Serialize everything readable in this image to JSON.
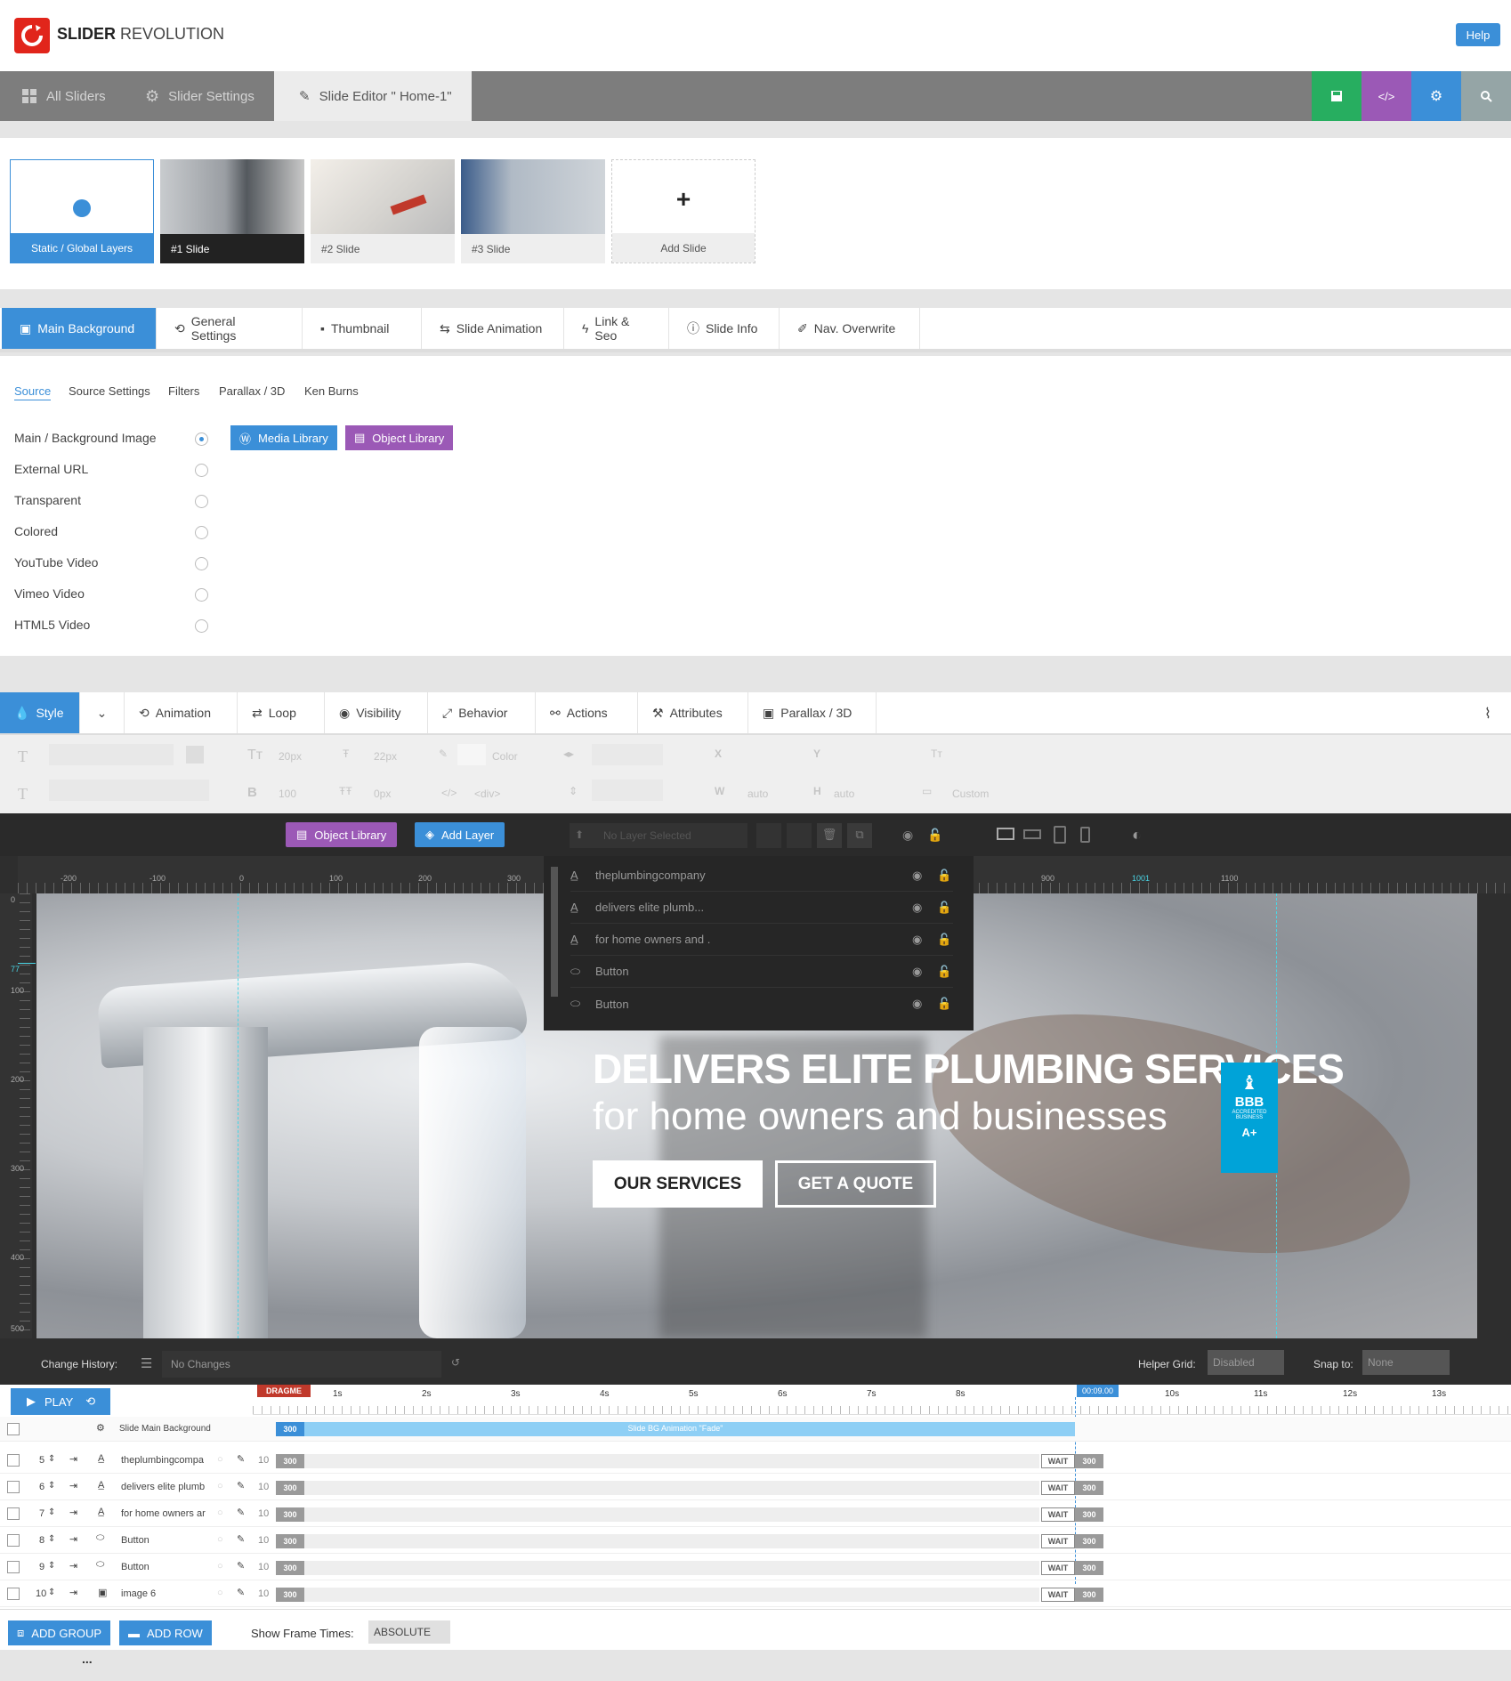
{
  "header": {
    "brand_bold": "SLIDER",
    "brand_light": "REVOLUTION",
    "help_label": "Help"
  },
  "nav": {
    "all_sliders": "All Sliders",
    "slider_settings": "Slider Settings",
    "slide_editor": "Slide Editor \" Home-1\"",
    "buttons": [
      {
        "icon": "save-icon",
        "color": "#27ae60"
      },
      {
        "icon": "code-icon",
        "glyph": "</>",
        "color": "#9b59b6"
      },
      {
        "icon": "gear-icon",
        "color": "#3b8fd8"
      },
      {
        "icon": "search-icon",
        "color": "#95a5a6"
      }
    ]
  },
  "slides": [
    {
      "label": "Static / Global Layers",
      "active": false
    },
    {
      "label": "#1 Slide",
      "active": true
    },
    {
      "label": "#2 Slide",
      "active": false
    },
    {
      "label": "#3 Slide",
      "active": false
    },
    {
      "label": "Add Slide",
      "active": false
    }
  ],
  "main_tabs": [
    "Main Background",
    "General Settings",
    "Thumbnail",
    "Slide Animation",
    "Link & Seo",
    "Slide Info",
    "Nav. Overwrite"
  ],
  "source_subtabs": [
    "Source",
    "Source Settings",
    "Filters",
    "Parallax / 3D",
    "Ken Burns"
  ],
  "source_options": [
    {
      "label": "Main / Background Image",
      "selected": true
    },
    {
      "label": "External URL",
      "selected": false
    },
    {
      "label": "Transparent",
      "selected": false
    },
    {
      "label": "Colored",
      "selected": false
    },
    {
      "label": "YouTube Video",
      "selected": false
    },
    {
      "label": "Vimeo Video",
      "selected": false
    },
    {
      "label": "HTML5 Video",
      "selected": false
    }
  ],
  "library_buttons": {
    "media": "Media Library",
    "object": "Object Library"
  },
  "layer_tabs": [
    "Style",
    "Animation",
    "Loop",
    "Visibility",
    "Behavior",
    "Actions",
    "Attributes",
    "Parallax / 3D"
  ],
  "style_toolbar": {
    "font_size": "20px",
    "line_height": "22px",
    "color_label": "Color",
    "font_weight": "100",
    "letter_spacing": "0px",
    "tag": "<div>",
    "x_label": "X",
    "y_label": "Y",
    "w_label": "W",
    "w_value": "auto",
    "h_label": "H",
    "h_value": "auto",
    "custom": "Custom"
  },
  "editor": {
    "object_library": "Object Library",
    "add_layer": "Add Layer",
    "no_layer": "No Layer Selected",
    "ruler_h": [
      "-200",
      "-100",
      "0",
      "100",
      "200",
      "300",
      "900",
      "1001",
      "1100"
    ],
    "ruler_v": [
      "0",
      "77",
      "100",
      "200",
      "300",
      "400",
      "500"
    ],
    "layers": [
      {
        "name": "theplumbingcompany",
        "icon": "text-icon"
      },
      {
        "name": "delivers elite plumb...",
        "icon": "text-icon"
      },
      {
        "name": "for home owners and .",
        "icon": "text-icon"
      },
      {
        "name": "Button",
        "icon": "button-icon"
      },
      {
        "name": "Button",
        "icon": "button-icon"
      }
    ],
    "headline": "DELIVERS ELITE PLUMBING SERVICES",
    "subheadline": "for home owners and businesses",
    "btn1": "OUR SERVICES",
    "btn2": "GET A QUOTE",
    "bbb": {
      "top": "BBB",
      "sub1": "ACCREDITED",
      "sub2": "BUSINESS",
      "rating": "A+"
    }
  },
  "change_history": {
    "label": "Change History:",
    "value": "No Changes",
    "helper_grid_label": "Helper Grid:",
    "helper_grid_value": "Disabled",
    "snap_label": "Snap to:",
    "snap_value": "None"
  },
  "timeline": {
    "play": "PLAY",
    "dragme": "DRAGME",
    "end_time": "00:09.00",
    "ticks": [
      "1s",
      "2s",
      "3s",
      "4s",
      "5s",
      "6s",
      "7s",
      "8s",
      "10s",
      "11s",
      "12s",
      "13s"
    ],
    "bg_row": {
      "name": "Slide Main Background",
      "start": "300",
      "anim": "Slide BG Animation \"Fade\""
    },
    "rows": [
      {
        "num": "5",
        "name": "theplumbingcompa",
        "icon": "text-icon",
        "offset": "10",
        "start": "300",
        "wait": "WAIT",
        "end": "300"
      },
      {
        "num": "6",
        "name": "delivers elite plumb",
        "icon": "text-icon",
        "offset": "10",
        "start": "300",
        "wait": "WAIT",
        "end": "300"
      },
      {
        "num": "7",
        "name": "for home owners ar",
        "icon": "text-icon",
        "offset": "10",
        "start": "300",
        "wait": "WAIT",
        "end": "300"
      },
      {
        "num": "8",
        "name": "Button",
        "icon": "button-icon",
        "offset": "10",
        "start": "300",
        "wait": "WAIT",
        "end": "300"
      },
      {
        "num": "9",
        "name": "Button",
        "icon": "button-icon",
        "offset": "10",
        "start": "300",
        "wait": "WAIT",
        "end": "300"
      },
      {
        "num": "10",
        "name": "image 6",
        "icon": "image-icon",
        "offset": "10",
        "start": "300",
        "wait": "WAIT",
        "end": "300"
      }
    ]
  },
  "footer": {
    "add_group": "ADD GROUP",
    "add_row": "ADD ROW",
    "frame_times_label": "Show Frame Times:",
    "frame_times_value": "ABSOLUTE",
    "more": "..."
  }
}
